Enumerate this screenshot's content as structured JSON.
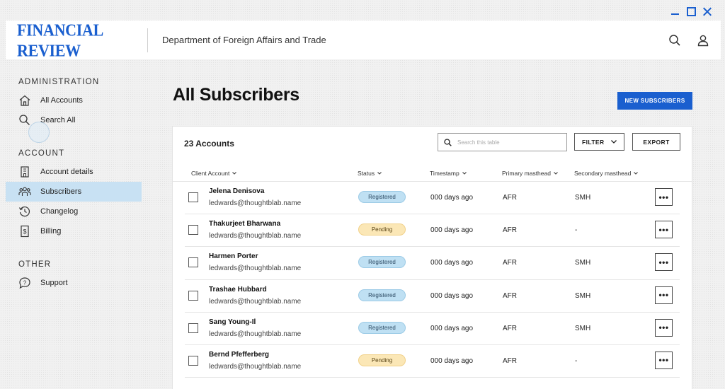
{
  "header": {
    "logo": "FINANCIAL REVIEW",
    "department": "Department of Foreign Affairs and Trade",
    "icons": [
      "search-icon",
      "user-icon"
    ]
  },
  "sidebar": {
    "sections": {
      "administration": {
        "title": "ADMINISTRATION",
        "items": [
          {
            "label": "All Accounts",
            "icon": "home-icon"
          },
          {
            "label": "Search All",
            "icon": "search-icon"
          }
        ]
      },
      "account": {
        "title": "ACCOUNT",
        "items": [
          {
            "label": "Account details",
            "icon": "building-icon"
          },
          {
            "label": "Subscribers",
            "icon": "users-icon",
            "active": true
          },
          {
            "label": "Changelog",
            "icon": "history-icon"
          },
          {
            "label": "Billing",
            "icon": "billing-icon"
          }
        ]
      },
      "other": {
        "title": "OTHER",
        "items": [
          {
            "label": "Support",
            "icon": "chat-help-icon"
          }
        ]
      }
    }
  },
  "main": {
    "title": "All Subscribers",
    "new_button": "NEW SUBSCRIBERS",
    "table": {
      "count_label": "23 Accounts",
      "search_placeholder": "Search this table",
      "filter_label": "FILTER",
      "export_label": "EXPORT",
      "columns": [
        "Client Account",
        "Status",
        "Timestamp",
        "Primary masthead",
        "Secondary masthead"
      ],
      "rows": [
        {
          "name": "Jelena Denisova",
          "email": "ledwards@thoughtblab.name",
          "status": "Registered",
          "timestamp": "000 days ago",
          "primary": "AFR",
          "secondary": "SMH"
        },
        {
          "name": "Thakurjeet Bharwana",
          "email": "ledwards@thoughtblab.name",
          "status": "Pending",
          "timestamp": "000 days ago",
          "primary": "AFR",
          "secondary": "-"
        },
        {
          "name": "Harmen Porter",
          "email": "ledwards@thoughtblab.name",
          "status": "Registered",
          "timestamp": "000 days ago",
          "primary": "AFR",
          "secondary": "SMH"
        },
        {
          "name": "Trashae Hubbard",
          "email": "ledwards@thoughtblab.name",
          "status": "Registered",
          "timestamp": "000 days ago",
          "primary": "AFR",
          "secondary": "SMH"
        },
        {
          "name": "Sang Young-Il",
          "email": "ledwards@thoughtblab.name",
          "status": "Registered",
          "timestamp": "000 days ago",
          "primary": "AFR",
          "secondary": "SMH"
        },
        {
          "name": "Bernd Pfefferberg",
          "email": "ledwards@thoughtblab.name",
          "status": "Pending",
          "timestamp": "000 days ago",
          "primary": "AFR",
          "secondary": "-"
        }
      ],
      "more_label": "•••"
    }
  }
}
